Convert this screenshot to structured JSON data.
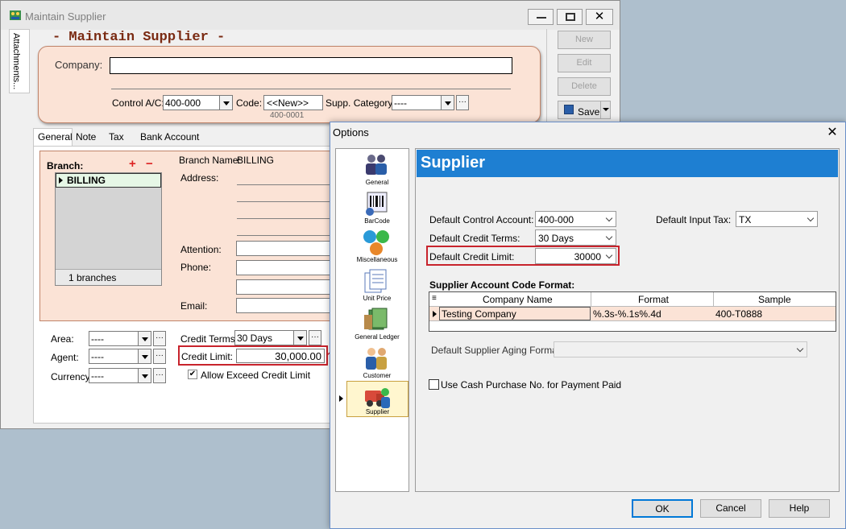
{
  "main_window": {
    "title": "Maintain Supplier",
    "side_tab": "Attachments...",
    "form_title": "- Maintain Supplier -",
    "company_label": "Company:",
    "company_value": "",
    "control_ac_label": "Control A/C:",
    "control_ac_value": "400-000",
    "code_label": "Code:",
    "code_value": "<<New>>",
    "supp_category_label": "Supp. Category:",
    "supp_category_value": "----",
    "code_preview": "400-0001",
    "buttons": {
      "new": "New",
      "edit": "Edit",
      "delete": "Delete",
      "save": "Save"
    },
    "tabs": [
      "General",
      "Note",
      "Tax",
      "Bank Account"
    ],
    "branch_label": "Branch:",
    "branch_add": "+",
    "branch_remove": "−",
    "branch_row": "BILLING",
    "branch_count": "1 branches",
    "branch_name_label": "Branch Name:",
    "branch_name_value": "BILLING",
    "address_label": "Address:",
    "attention_label": "Attention:",
    "phone_label": "Phone:",
    "email_label": "Email:",
    "area_label": "Area:",
    "area_value": "----",
    "agent_label": "Agent:",
    "agent_value": "----",
    "currency_label": "Currency:",
    "currency_value": "----",
    "credit_terms_label": "Credit Terms:",
    "credit_terms_value": "30 Days",
    "credit_limit_label": "Credit Limit:",
    "credit_limit_value": "30,000.00",
    "allow_exceed_label": "Allow Exceed Credit Limit",
    "allow_exceed_checked": true
  },
  "options_dialog": {
    "title": "Options",
    "sidebar": [
      {
        "label": "General",
        "icon": "users-icon"
      },
      {
        "label": "BarCode",
        "icon": "barcode-icon"
      },
      {
        "label": "Miscellaneous",
        "icon": "balls-icon"
      },
      {
        "label": "Unit Price",
        "icon": "documents-icon"
      },
      {
        "label": "General Ledger",
        "icon": "ledger-icon"
      },
      {
        "label": "Customer",
        "icon": "customer-icon"
      },
      {
        "label": "Supplier",
        "icon": "supplier-icon"
      }
    ],
    "header": "Supplier",
    "default_control_account_label": "Default Control Account:",
    "default_control_account_value": "400-000",
    "default_input_tax_label": "Default Input Tax:",
    "default_input_tax_value": "TX",
    "default_credit_terms_label": "Default Credit Terms:",
    "default_credit_terms_value": "30 Days",
    "default_credit_limit_label": "Default Credit Limit:",
    "default_credit_limit_value": "30000",
    "code_format_title": "Supplier Account Code Format:",
    "grid_columns": [
      "Company Name",
      "Format",
      "Sample"
    ],
    "grid_rows": [
      [
        "Testing Company",
        "%.3s-%.1s%.4d",
        "400-T0888"
      ]
    ],
    "aging_format_label": "Default Supplier Aging Format:",
    "aging_format_value": "",
    "use_cash_purchase_label": "Use Cash Purchase No. for Payment Paid",
    "use_cash_purchase_checked": false,
    "buttons": {
      "ok": "OK",
      "cancel": "Cancel",
      "help": "Help"
    }
  },
  "colors": {
    "highlight": "#c8232c",
    "header_blue": "#1e7fd2",
    "peach": "#fbe3d6"
  }
}
